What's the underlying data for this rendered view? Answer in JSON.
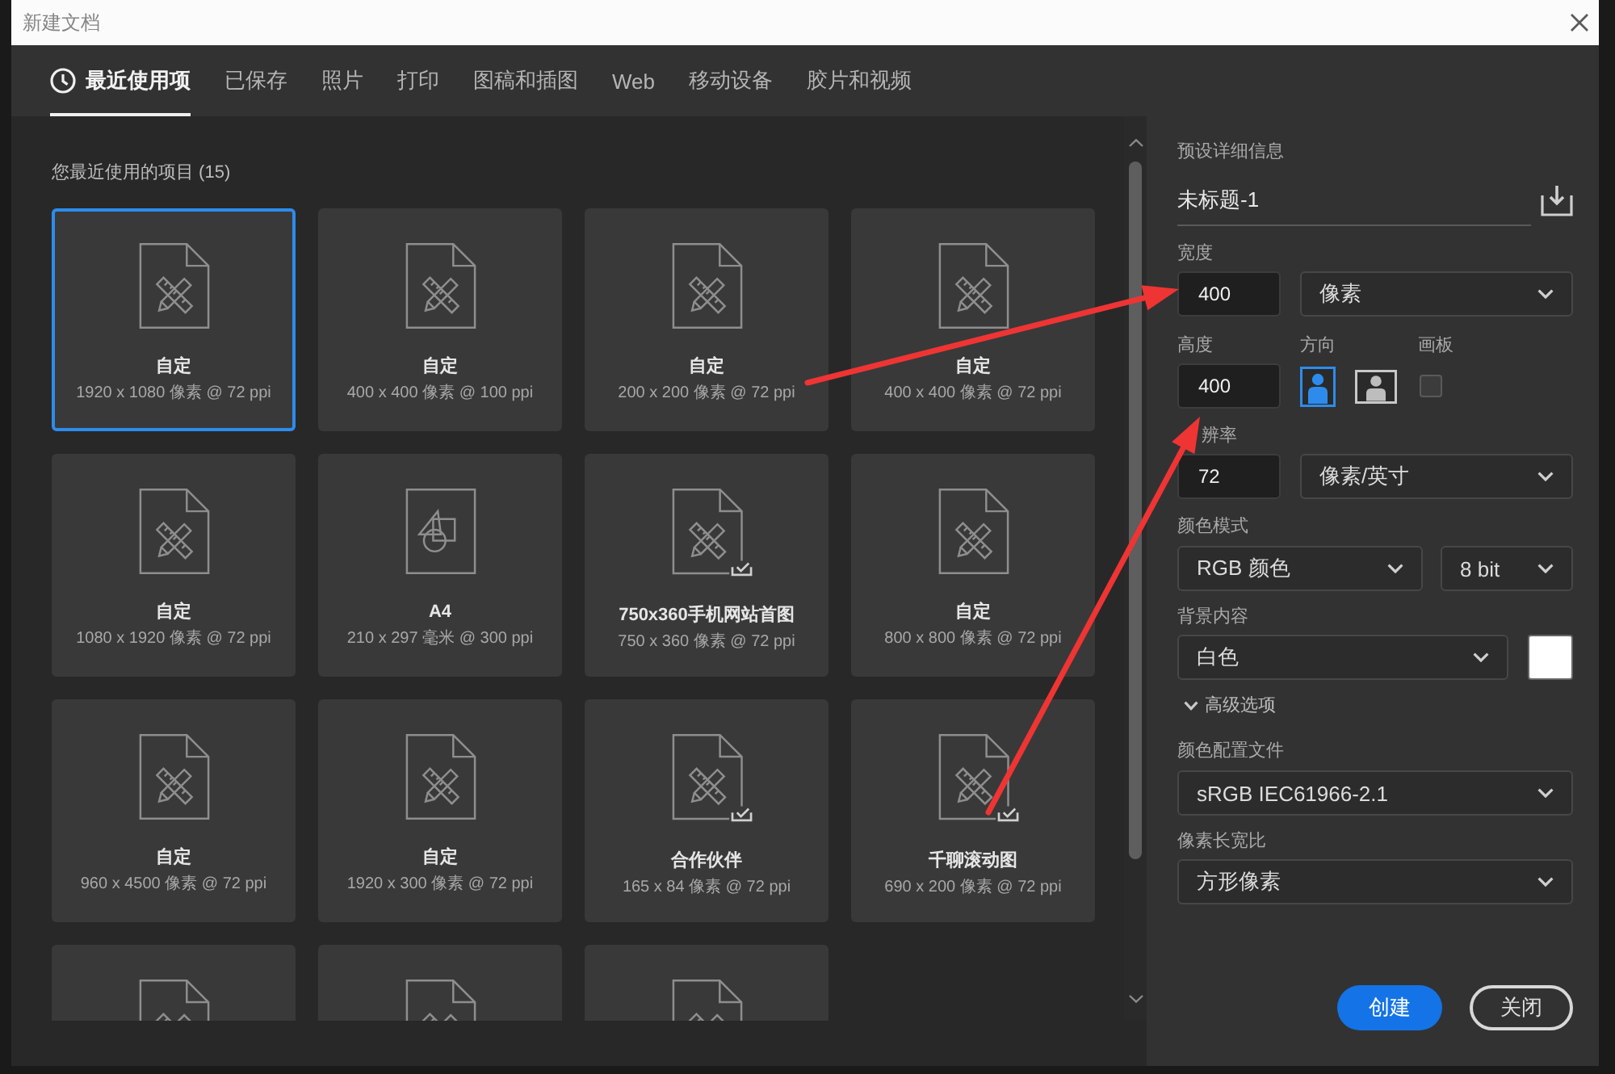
{
  "window": {
    "title": "新建文档"
  },
  "tabs": [
    {
      "label": "最近使用项",
      "kind": "recent",
      "selected": true
    },
    {
      "label": "已保存",
      "kind": "category",
      "selected": false
    },
    {
      "label": "照片",
      "kind": "category",
      "selected": false
    },
    {
      "label": "打印",
      "kind": "category",
      "selected": false
    },
    {
      "label": "图稿和插图",
      "kind": "category",
      "selected": false
    },
    {
      "label": "Web",
      "kind": "category",
      "selected": false
    },
    {
      "label": "移动设备",
      "kind": "category",
      "selected": false
    },
    {
      "label": "胶片和视频",
      "kind": "category",
      "selected": false
    }
  ],
  "recent": {
    "heading": "您最近使用的项目 (15)",
    "cards": [
      {
        "kind": "custom",
        "title": "自定",
        "subtitle": "1920 x 1080 像素 @ 72 ppi",
        "selected": true
      },
      {
        "kind": "custom",
        "title": "自定",
        "subtitle": "400 x 400 像素 @ 100 ppi",
        "selected": false
      },
      {
        "kind": "custom",
        "title": "自定",
        "subtitle": "200 x 200 像素 @ 72 ppi",
        "selected": false
      },
      {
        "kind": "custom",
        "title": "自定",
        "subtitle": "400 x 400 像素 @ 72 ppi",
        "selected": false
      },
      {
        "kind": "custom",
        "title": "自定",
        "subtitle": "1080 x 1920 像素 @ 72 ppi",
        "selected": false
      },
      {
        "kind": "print",
        "title": "A4",
        "subtitle": "210 x 297 毫米 @ 300 ppi",
        "selected": false
      },
      {
        "kind": "template",
        "title": "750x360手机网站首图",
        "subtitle": "750 x 360 像素 @ 72 ppi",
        "selected": false
      },
      {
        "kind": "custom",
        "title": "自定",
        "subtitle": "800 x 800 像素 @ 72 ppi",
        "selected": false
      },
      {
        "kind": "custom",
        "title": "自定",
        "subtitle": "960 x 4500 像素 @ 72 ppi",
        "selected": false
      },
      {
        "kind": "custom",
        "title": "自定",
        "subtitle": "1920 x 300 像素 @ 72 ppi",
        "selected": false
      },
      {
        "kind": "template",
        "title": "合作伙伴",
        "subtitle": "165 x 84 像素 @ 72 ppi",
        "selected": false
      },
      {
        "kind": "template",
        "title": "千聊滚动图",
        "subtitle": "690 x 200 像素 @ 72 ppi",
        "selected": false
      },
      {
        "kind": "custom",
        "selected": false
      },
      {
        "kind": "custom",
        "selected": false
      },
      {
        "kind": "custom",
        "selected": false
      }
    ]
  },
  "details": {
    "heading": "预设详细信息",
    "name": "未标题-1",
    "width": {
      "label": "宽度",
      "value": "400",
      "unit": "像素"
    },
    "height": {
      "label": "高度",
      "value": "400"
    },
    "orientation": {
      "label": "方向",
      "options": [
        {
          "kind": "portrait",
          "selected": true
        },
        {
          "kind": "landscape",
          "selected": false
        }
      ]
    },
    "artboard": {
      "label": "画板",
      "checked": false
    },
    "resolution": {
      "label": "辨率",
      "value": "72",
      "unit": "像素/英寸"
    },
    "color_mode": {
      "label": "颜色模式",
      "mode": "RGB 颜色",
      "depth": "8 bit"
    },
    "background": {
      "label": "背景内容",
      "value": "白色",
      "color": "#ffffff"
    },
    "advanced": {
      "label": "高级选项",
      "expanded": true
    },
    "color_profile": {
      "label": "颜色配置文件",
      "value": "sRGB IEC61966-2.1"
    },
    "pixel_aspect": {
      "label": "像素长宽比",
      "value": "方形像素"
    }
  },
  "buttons": [
    {
      "label": "创建",
      "kind": "primary"
    },
    {
      "label": "关闭",
      "kind": "secondary"
    }
  ]
}
